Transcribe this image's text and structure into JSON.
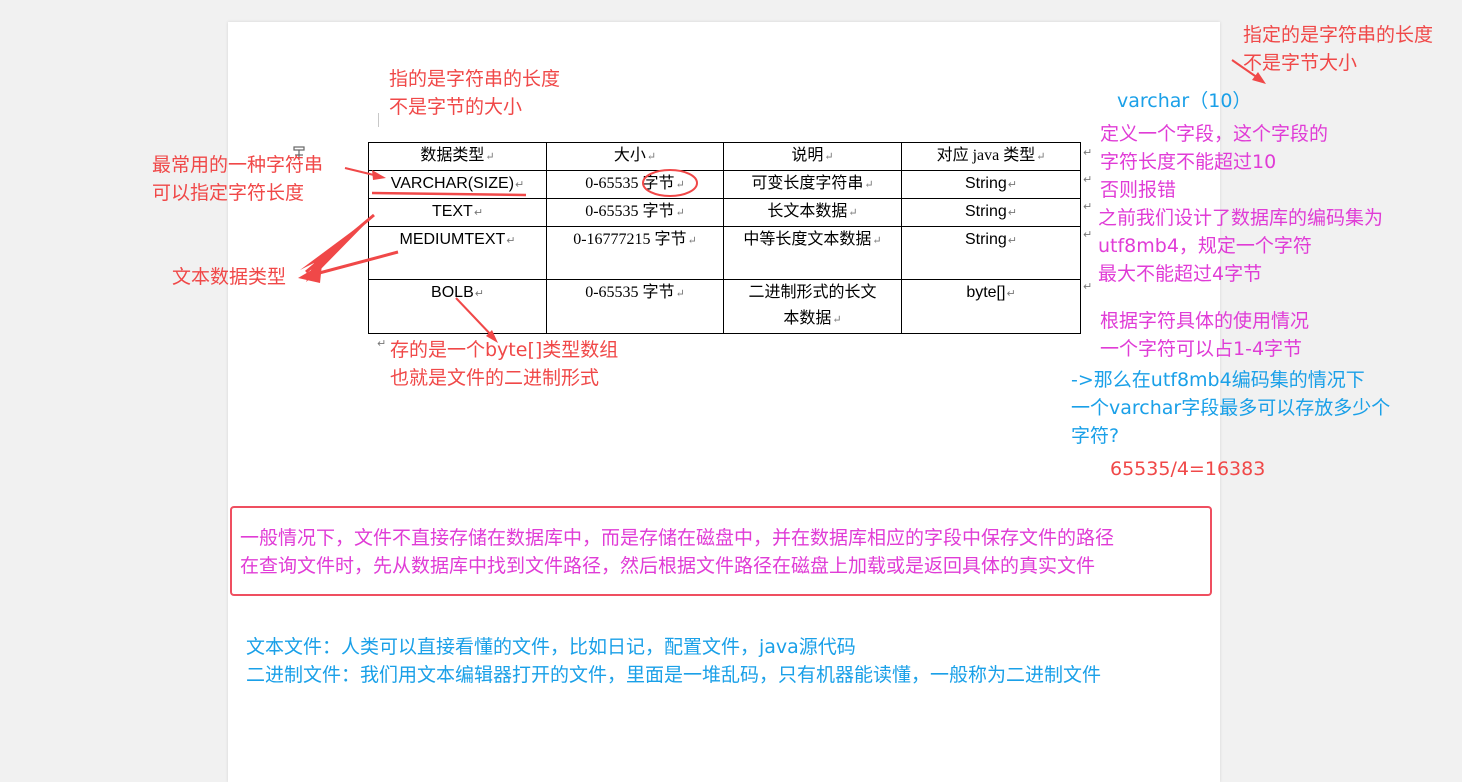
{
  "table": {
    "headers": [
      "数据类型",
      "大小",
      "说明",
      "对应 java 类型"
    ],
    "rows": [
      [
        "VARCHAR(SIZE)",
        "0-65535 字节",
        "可变长度字符串",
        "String"
      ],
      [
        "TEXT",
        "0-65535 字节",
        "长文本数据",
        "String"
      ],
      [
        "MEDIUMTEXT",
        "0-16777215 字节",
        "中等长度文本数据",
        "String"
      ],
      [
        "BOLB",
        "0-65535 字节",
        "二进制形式的长文本数据",
        "byte[]"
      ]
    ]
  },
  "annotations": {
    "top_note_line1": "指的是字符串的长度",
    "top_note_line2": "不是字节的大小",
    "varchar_note_line1": "最常用的一种字符串",
    "varchar_note_line2": "可以指定字符长度",
    "text_types_note": "文本数据类型",
    "bolb_note_line1": "存的是一个byte[]类型数组",
    "bolb_note_line2": "也就是文件的二进制形式",
    "right_top_line1": "指定的是字符串的长度",
    "right_top_line2": "不是字节大小",
    "varchar_example": "varchar（10）",
    "define_line1": "定义一个字段，这个字段的",
    "define_line2": "字符长度不能超过10",
    "define_line3": "否则报错",
    "charset_line1": "之前我们设计了数据库的编码集为",
    "charset_line2": "utf8mb4，规定一个字符",
    "charset_line3": "最大不能超过4字节",
    "usage_line1": "根据字符具体的使用情况",
    "usage_line2": "一个字符可以占1-4字节",
    "question_line1": "->那么在utf8mb4编码集的情况下",
    "question_line2": "一个varchar字段最多可以存放多少个",
    "question_line3": "字符?",
    "calculation": "65535/4=16383"
  },
  "info_box": {
    "line1": "一般情况下，文件不直接存储在数据库中，而是存储在磁盘中，并在数据库相应的字段中保存文件的路径",
    "line2": "在查询文件时，先从数据库中找到文件路径，然后根据文件路径在磁盘上加载或是返回具体的真实文件"
  },
  "file_types": {
    "text_file": "文本文件：人类可以直接看懂的文件，比如日记，配置文件，java源代码",
    "binary_file": "二进制文件：我们用文本编辑器打开的文件，里面是一堆乱码，只有机器能读懂，一般称为二进制文件"
  },
  "colors": {
    "red": "#f04848",
    "pink": "#e03cd6",
    "blue": "#1aa0e8",
    "box_border": "#ef4f60"
  },
  "icons": {
    "paragraph_mark": "↵",
    "table_handle": "table-move-handle-icon"
  }
}
